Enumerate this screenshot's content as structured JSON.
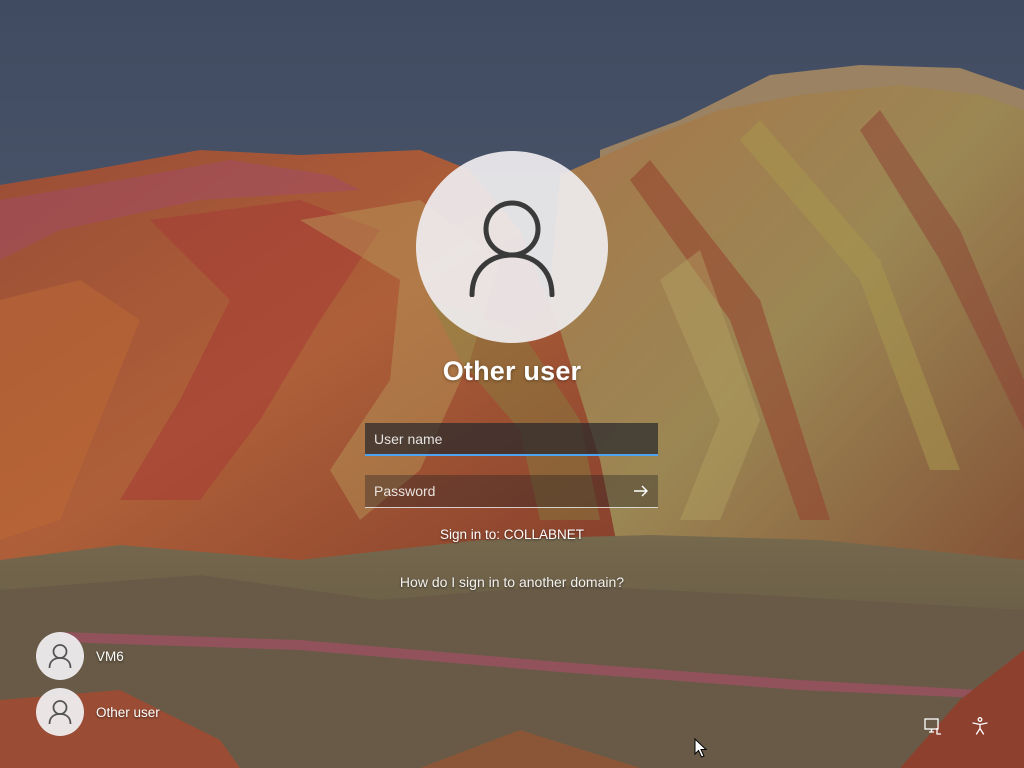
{
  "login": {
    "title": "Other user",
    "username_placeholder": "User name",
    "username_value": "",
    "password_placeholder": "Password",
    "sign_in_to": "Sign in to: COLLABNET",
    "other_domain_link": "How do I sign in to another domain?"
  },
  "users": [
    {
      "name": "VM6",
      "icon": "user-icon"
    },
    {
      "name": "Other user",
      "icon": "user-icon"
    }
  ],
  "system_buttons": [
    {
      "icon": "network-icon"
    },
    {
      "icon": "accessibility-icon"
    }
  ],
  "colors": {
    "focus_underline": "#4ea4f2",
    "avatar_background": "#eeecee",
    "avatar_glyph": "#3a3a3a"
  }
}
